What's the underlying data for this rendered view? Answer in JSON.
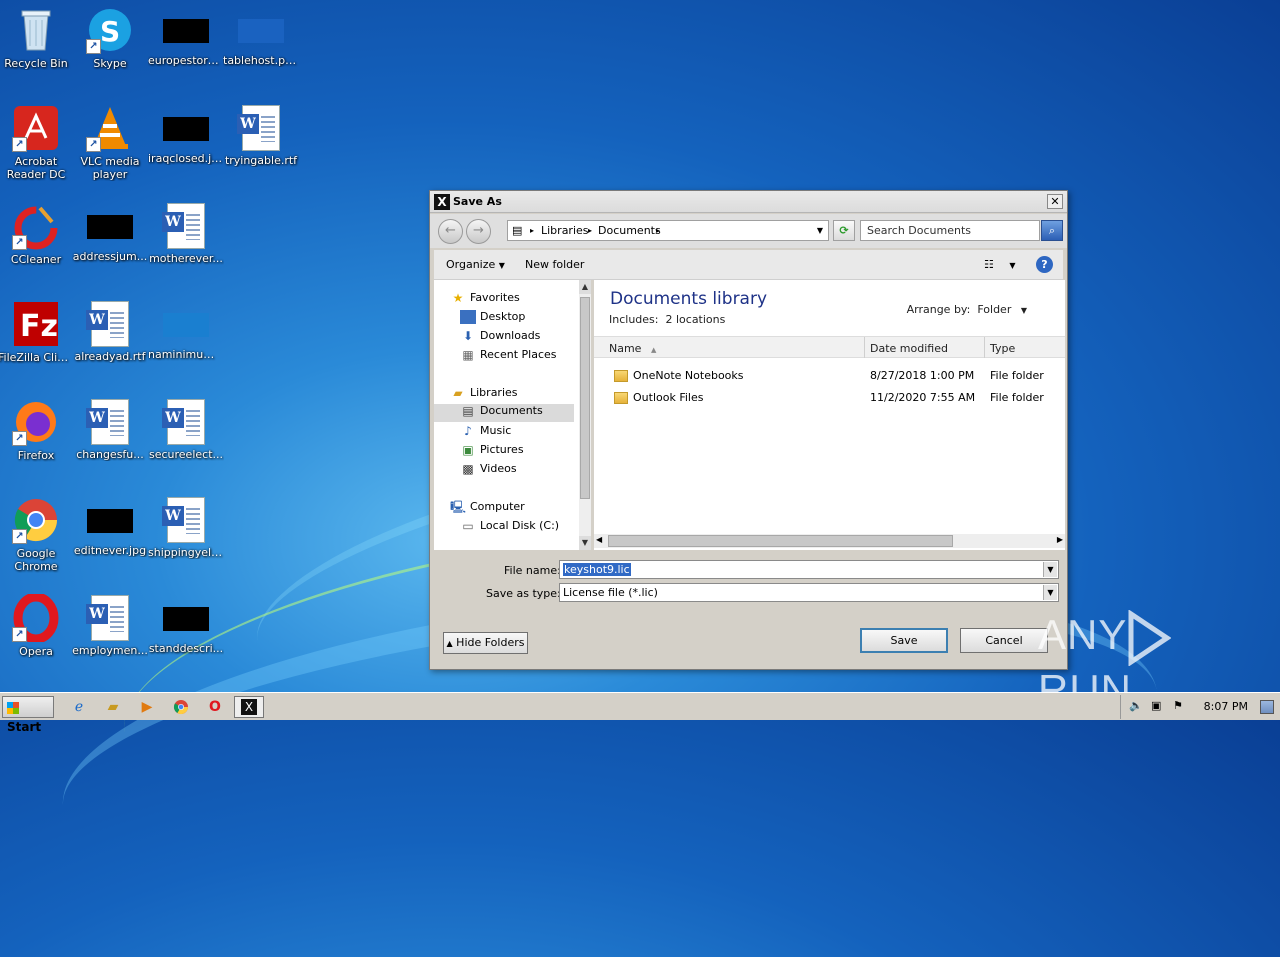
{
  "desktop": {
    "icons": [
      {
        "label": "Recycle Bin"
      },
      {
        "label": "Skype"
      },
      {
        "label": "europestore..."
      },
      {
        "label": "tablehost.png"
      },
      {
        "label": "Acrobat Reader DC"
      },
      {
        "label": "VLC media player"
      },
      {
        "label": "iraqclosed.jpg"
      },
      {
        "label": "tryingable.rtf"
      },
      {
        "label": "CCleaner"
      },
      {
        "label": "addressjum..."
      },
      {
        "label": "motherever..."
      },
      {
        "label": "FileZilla Client"
      },
      {
        "label": "alreadyad.rtf"
      },
      {
        "label": "naminimum...."
      },
      {
        "label": "Firefox"
      },
      {
        "label": "changesfu..."
      },
      {
        "label": "secureelect..."
      },
      {
        "label": "Google Chrome"
      },
      {
        "label": "editnever.jpg"
      },
      {
        "label": "shippingyell..."
      },
      {
        "label": "Opera"
      },
      {
        "label": "employmen..."
      },
      {
        "label": "standdescri..."
      }
    ]
  },
  "dialog": {
    "title": "Save As",
    "address": {
      "crumb1": "Libraries",
      "crumb2": "Documents"
    },
    "search_placeholder": "Search Documents",
    "toolbar": {
      "organize": "Organize",
      "new_folder": "New folder",
      "help": "?"
    },
    "nav": {
      "favorites": "Favorites",
      "desktop": "Desktop",
      "downloads": "Downloads",
      "recent": "Recent Places",
      "libraries": "Libraries",
      "documents": "Documents",
      "music": "Music",
      "pictures": "Pictures",
      "videos": "Videos",
      "computer": "Computer",
      "local_disk": "Local Disk (C:)"
    },
    "library": {
      "title": "Documents library",
      "includes_label": "Includes:",
      "includes_value": "2 locations",
      "arrange_label": "Arrange by:",
      "arrange_value": "Folder"
    },
    "columns": {
      "name": "Name",
      "date": "Date modified",
      "type": "Type"
    },
    "files": [
      {
        "name": "OneNote Notebooks",
        "date": "8/27/2018 1:00 PM",
        "type": "File folder"
      },
      {
        "name": "Outlook Files",
        "date": "11/2/2020 7:55 AM",
        "type": "File folder"
      }
    ],
    "file_name_label": "File name:",
    "file_name_value": "keyshot9.lic",
    "save_type_label": "Save as type:",
    "save_type_value": "License file (*.lic)",
    "hide_folders": "Hide Folders",
    "save": "Save",
    "cancel": "Cancel"
  },
  "taskbar": {
    "start": "Start",
    "clock": "8:07 PM"
  },
  "watermark": {
    "left": "ANY",
    "right": "RUN"
  }
}
